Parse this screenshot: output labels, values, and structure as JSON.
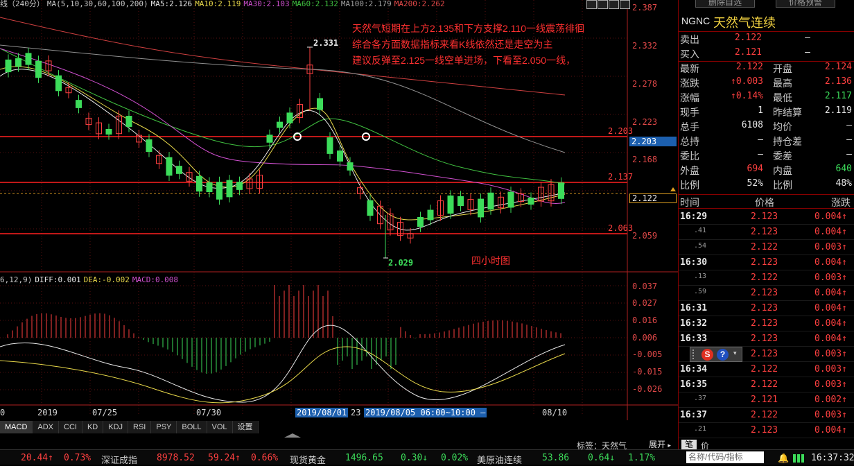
{
  "chart": {
    "symbol_title": "线（240分）",
    "ma_legend": [
      {
        "label": "MA(5,10,30,60,100,200)",
        "color": "#c8c8c8"
      },
      {
        "label": "MA5:2.126",
        "color": "#e8e8e8"
      },
      {
        "label": "MA10:2.119",
        "color": "#e8d84a"
      },
      {
        "label": "MA30:2.103",
        "color": "#d050d0"
      },
      {
        "label": "MA60:2.132",
        "color": "#40c040"
      },
      {
        "label": "MA100:2.179",
        "color": "#a0a0a0"
      },
      {
        "label": "MA200:2.262",
        "color": "#e04848"
      }
    ],
    "price_axis": [
      "2.387",
      "2.332",
      "2.278",
      "2.223",
      "2.168",
      "2.059"
    ],
    "price_axis_highlight": "2.203",
    "current_price_tag": "2.122",
    "lines": [
      {
        "label": "2.203"
      },
      {
        "label": "2.137"
      },
      {
        "label": "2.063"
      }
    ],
    "peak_label": "2.331",
    "trough_label": "2.029",
    "annotation_lines": [
      "天然气短期在上方2.135和下方支撑2.110一线震荡徘徊",
      "综合各方面数据指标来看K线依然还是走空为主",
      "建议反弹至2.125一线空单进场，下看至2.050一线，"
    ],
    "period_label": "四小时图",
    "macd_legend": [
      {
        "label": "6,12,9)",
        "color": "#c8c8c8"
      },
      {
        "label": "DIFF:0.001",
        "color": "#e8e8e8"
      },
      {
        "label": "DEA:-0.002",
        "color": "#e8d84a"
      },
      {
        "label": "MACD:0.008",
        "color": "#d050d0"
      }
    ],
    "macd_axis": [
      "0.037",
      "0.027",
      "0.016",
      "0.006",
      "-0.005",
      "-0.015",
      "-0.026"
    ],
    "dates": {
      "d0": "0",
      "d1": "2019",
      "d2": "07/25",
      "d3": "07/30",
      "d4": "2019/08/01",
      "d4b": "23",
      "d5": "2019/08/05 06:00~10:00 —",
      "d6": "08/10"
    }
  },
  "tabs": [
    "MACD",
    "ADX",
    "CCI",
    "KD",
    "KDJ",
    "RSI",
    "PSY",
    "BOLL",
    "VOL",
    "设置"
  ],
  "bottom_bar": {
    "tag": "标签：天然气",
    "expand": "展开",
    "pen": "笔",
    "price": "价"
  },
  "top_buttons": {
    "delete_fav": "删除自选",
    "price_alert": "价格预警"
  },
  "quote": {
    "code": "NGNC",
    "name": "天然气连续",
    "sell": {
      "label": "卖出",
      "value": "2.122",
      "vol": "—"
    },
    "buy": {
      "label": "买入",
      "value": "2.121",
      "vol": "—"
    },
    "rows": [
      {
        "l1": "最新",
        "v1": "2.122",
        "c1": "red",
        "l2": "开盘",
        "v2": "2.124",
        "c2": "red"
      },
      {
        "l1": "涨跌",
        "v1": "↑0.003",
        "c1": "red",
        "l2": "最高",
        "v2": "2.136",
        "c2": "red"
      },
      {
        "l1": "涨幅",
        "v1": "↑0.14%",
        "c1": "red",
        "l2": "最低",
        "v2": "2.117",
        "c2": "green"
      },
      {
        "l1": "现手",
        "v1": "1",
        "c1": "white",
        "l2": "昨结算",
        "v2": "2.119",
        "c2": "white"
      },
      {
        "l1": "总手",
        "v1": "6108",
        "c1": "white",
        "l2": "均价",
        "v2": "—",
        "c2": "white"
      },
      {
        "l1": "总持",
        "v1": "—",
        "c1": "white",
        "l2": "持仓差",
        "v2": "—",
        "c2": "white"
      },
      {
        "l1": "委比",
        "v1": "—",
        "c1": "white",
        "l2": "委差",
        "v2": "—",
        "c2": "white"
      },
      {
        "l1": "外盘",
        "v1": "694",
        "c1": "red",
        "l2": "内盘",
        "v2": "640",
        "c2": "green"
      },
      {
        "l1": "比例",
        "v1": "52%",
        "c1": "white",
        "l2": "比例",
        "v2": "48%",
        "c2": "white"
      }
    ],
    "tick_header": {
      "time": "时间",
      "price": "价格",
      "change": "涨跌"
    },
    "ticks": [
      {
        "time": "16:29",
        "sub": false,
        "price": "2.123",
        "chg": "0.004↑"
      },
      {
        "time": ".41",
        "sub": true,
        "price": "2.123",
        "chg": "0.004↑"
      },
      {
        "time": ".54",
        "sub": true,
        "price": "2.122",
        "chg": "0.003↑"
      },
      {
        "time": "16:30",
        "sub": false,
        "price": "2.123",
        "chg": "0.004↑"
      },
      {
        "time": ".13",
        "sub": true,
        "price": "2.122",
        "chg": "0.003↑"
      },
      {
        "time": ".59",
        "sub": true,
        "price": "2.123",
        "chg": "0.004↑"
      },
      {
        "time": "16:31",
        "sub": false,
        "price": "2.123",
        "chg": "0.004↑"
      },
      {
        "time": "16:32",
        "sub": false,
        "price": "2.123",
        "chg": "0.004↑"
      },
      {
        "time": "16:33",
        "sub": false,
        "price": "2.123",
        "chg": "0.004↑"
      },
      {
        "time": "",
        "sub": true,
        "price": "2.123",
        "chg": "0.003↑"
      },
      {
        "time": "16:34",
        "sub": false,
        "price": "2.122",
        "chg": "0.003↑"
      },
      {
        "time": "16:35",
        "sub": false,
        "price": "2.122",
        "chg": "0.003↑"
      },
      {
        "time": ".37",
        "sub": true,
        "price": "2.121",
        "chg": "0.002↑"
      },
      {
        "time": "16:37",
        "sub": false,
        "price": "2.122",
        "chg": "0.003↑"
      },
      {
        "time": ".21",
        "sub": true,
        "price": "2.123",
        "chg": "0.004↑"
      }
    ],
    "search_placeholder": "名称/代码/指标"
  },
  "status": {
    "v1": "20.44↑",
    "p1": "0.73%",
    "name2": "深证成指",
    "v2": "8978.52",
    "c2": "59.24↑",
    "p2": "0.66%",
    "name3": "现货黄金",
    "v3": "1496.65",
    "c3": "0.30↓",
    "p3": "0.02%",
    "name4": "美原油连续",
    "v4": "53.86",
    "c4": "0.64↓",
    "p4": "1.17%",
    "clock": "16:37:32"
  },
  "colors": {
    "up": "#ff4040",
    "down": "#3cdc5a",
    "hline": "#ff2020"
  }
}
